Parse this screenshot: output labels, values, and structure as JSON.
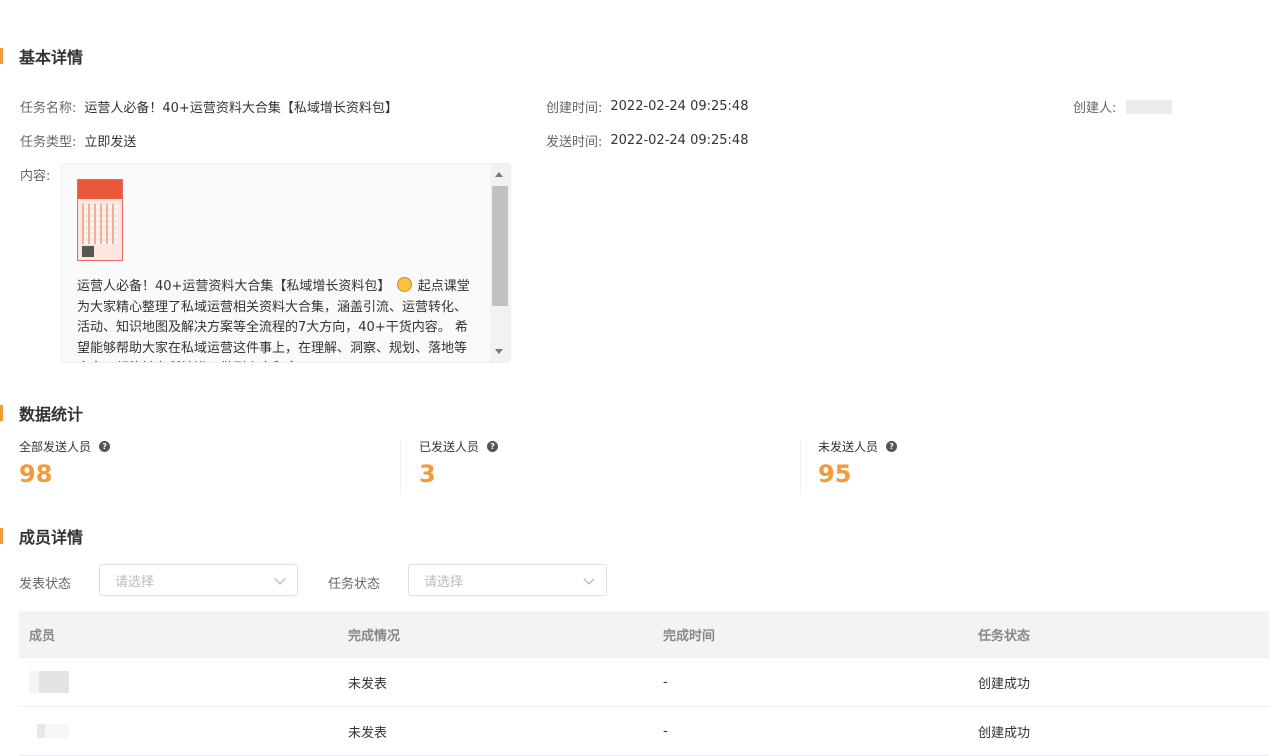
{
  "basic": {
    "title": "基本详情",
    "task_name_label": "任务名称:",
    "task_name": "运营人必备！40+运营资料大合集【私域增长资料包】",
    "created_time_label": "创建时间:",
    "created_time": "2022-02-24 09:25:48",
    "creator_label": "创建人:",
    "creator": "",
    "task_type_label": "任务类型:",
    "task_type": "立即发送",
    "send_time_label": "发送时间:",
    "send_time": "2022-02-24 09:25:48",
    "content_label": "内容:",
    "content_line1": "运营人必备！40+运营资料大合集【私域增长资料包】",
    "content_rest": "起点课堂为大家精心整理了私域运营相关资料大合集，涵盖引流、运营转化、活动、知识地图及解决方案等全流程的7大方向，40+干货内容。 希望能够帮助大家在私域运营这件事上，在理解、洞察、规划、落地等方向，都能够有所精进，做到个人和企"
  },
  "stats": {
    "title": "数据统计",
    "items": [
      {
        "label": "全部发送人员",
        "value": "98"
      },
      {
        "label": "已发送人员",
        "value": "3"
      },
      {
        "label": "未发送人员",
        "value": "95"
      }
    ],
    "accent_color": "#f39a3a"
  },
  "members": {
    "title": "成员详情",
    "filter1_label": "发表状态",
    "filter1_placeholder": "请选择",
    "filter2_label": "任务状态",
    "filter2_placeholder": "请选择",
    "columns": [
      "成员",
      "完成情况",
      "完成时间",
      "任务状态"
    ],
    "rows": [
      {
        "member": "",
        "completion": "未发表",
        "time": "-",
        "status": "创建成功"
      },
      {
        "member": "",
        "completion": "未发表",
        "time": "-",
        "status": "创建成功"
      }
    ]
  }
}
